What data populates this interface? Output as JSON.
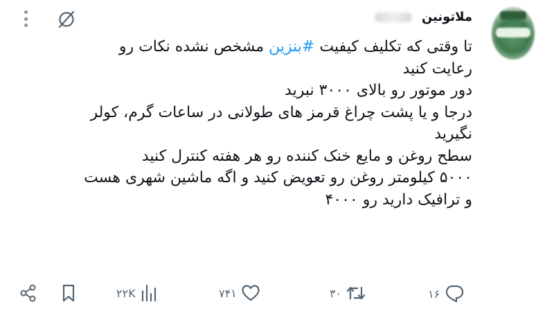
{
  "author": {
    "display_name": "ملاتونین",
    "avatar_icon": "avatar-image"
  },
  "tweet": {
    "line1_pre": "تا وقتی که تکلیف کیفیت ",
    "hashtag": "#بنزین",
    "line1_post": " مشخص نشده  نکات رو",
    "lines": [
      "رعایت کنید",
      "دور موتور رو بالای ۳۰۰۰ نبرید",
      "درجا و یا پشت چراغ قرمز های طولانی در ساعات گرم، کولر",
      "نگیرید",
      "سطح روغن و  مایع خنک کننده رو هر هفته کنترل کنید",
      "۵۰۰۰ کیلومتر روغن رو تعویض کنید و اگه ماشین شهری هست",
      "و ترافیک دارید رو ۴۰۰۰"
    ]
  },
  "actions": {
    "replies": "۱۶",
    "retweets": "۳۰",
    "likes": "۷۴۱",
    "views": "۲۲K"
  },
  "icons": {
    "reply": "reply-icon",
    "retweet": "retweet-icon",
    "like": "heart-icon",
    "views": "views-icon",
    "bookmark": "bookmark-icon",
    "share": "share-icon",
    "grok": "grok-icon",
    "more": "more-icon"
  },
  "colors": {
    "text": "#0f1419",
    "muted": "#536471",
    "hashtag": "#1d9bf0"
  }
}
